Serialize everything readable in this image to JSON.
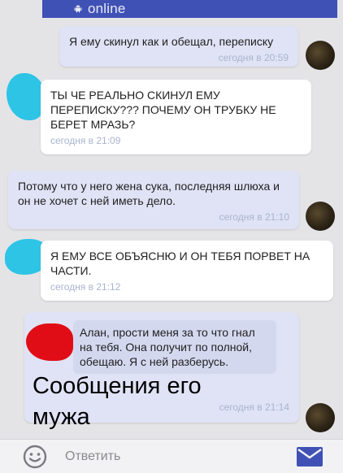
{
  "header": {
    "status_text": "online",
    "status_icon": "android-icon",
    "accent_color": "#3f51b5"
  },
  "messages": [
    {
      "direction": "outgoing",
      "text": "Я ему скинул как и обещал, переписку",
      "time": "сегодня в 20:59"
    },
    {
      "direction": "incoming",
      "text": "ТЫ ЧЕ РЕАЛЬНО СКИНУЛ ЕМУ ПЕРЕПИСКУ??? ПОЧЕМУ ОН ТРУБКУ НЕ БЕРЕТ МРАЗЬ?",
      "time": "сегодня в 21:09"
    },
    {
      "direction": "outgoing",
      "text": "Потому что у него жена сука, последняя шлюха и он не хочет с ней иметь дело.",
      "time": "сегодня в 21:10"
    },
    {
      "direction": "incoming",
      "text": "Я ЕМУ ВСЕ ОБЪЯСНЮ И ОН ТЕБЯ ПОРВЕТ НА ЧАСТИ.",
      "time": "сегодня в 21:12"
    },
    {
      "direction": "outgoing",
      "text": "Алан, прости меня за то что гнал на тебя. Она получит по полной, обещаю. Я с ней разберусь.",
      "time": "сегодня в 21:14"
    }
  ],
  "overlay_caption": "Сообщения его мужа",
  "input_bar": {
    "placeholder": "Ответить",
    "emoji_icon": "smile-icon",
    "send_icon": "envelope-icon",
    "send_color": "#3f51b5"
  }
}
